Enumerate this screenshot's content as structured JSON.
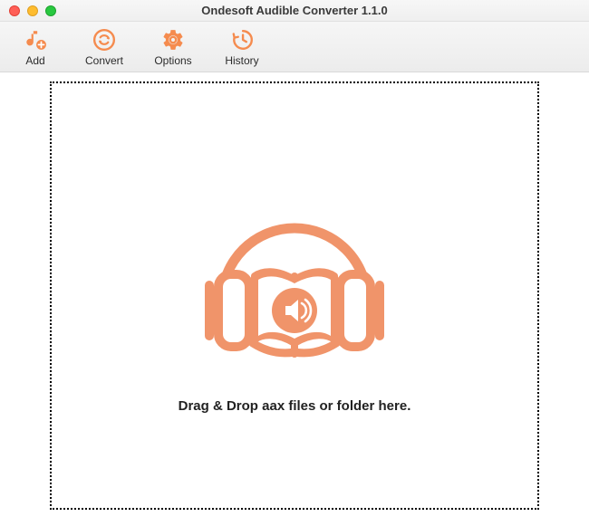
{
  "window": {
    "title": "Ondesoft Audible Converter 1.1.0"
  },
  "toolbar": {
    "add_label": "Add",
    "convert_label": "Convert",
    "options_label": "Options",
    "history_label": "History"
  },
  "dropzone": {
    "instruction": "Drag & Drop aax files or folder here."
  },
  "colors": {
    "accent": "#f58b4e"
  },
  "icons": {
    "add": "music-note-plus-icon",
    "convert": "refresh-circle-icon",
    "options": "gear-icon",
    "history": "clock-back-icon",
    "dropzone": "audiobook-headphones-icon"
  }
}
